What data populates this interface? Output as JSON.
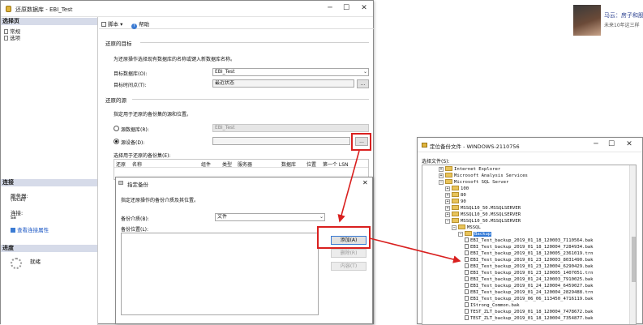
{
  "ad": {
    "title": "马云：房子和股",
    "subtitle": "未来10年这三样"
  },
  "restore": {
    "title": "还原数据库 - EBI_Test",
    "left_header": "选择页",
    "pages": [
      "常规",
      "选项"
    ],
    "toolbar": {
      "script": "脚本",
      "help": "帮助"
    },
    "target_section": "还原的目标",
    "target_desc": "为还原操作选择现有数据库的名称或键入新数据库名称。",
    "target_db_label": "目标数据库(O):",
    "target_db_value": "EBI_Test",
    "target_time_label": "目标时间点(T):",
    "target_time_value": "最近状态",
    "source_section": "还原的源",
    "source_desc": "指定用于还原的备份集的源和位置。",
    "source_db_label": "源数据库(R):",
    "source_db_value": "EBI_Test",
    "source_dev_label": "源设备(D):",
    "browse_label": "...",
    "backupsets_label": "选择用于还原的备份集(E):",
    "columns": [
      "还原",
      "名称",
      "组件",
      "类型",
      "服务器",
      "数据库",
      "位置",
      "第一个 LSN"
    ],
    "conn_header": "连接",
    "server_label": "服务器:",
    "server_value": "(local)",
    "conn_label": "连接:",
    "conn_value": "sa",
    "conn_props_link": "查看连接属性",
    "progress_header": "进度",
    "progress_status": "就绪"
  },
  "specify": {
    "title": "指定备份",
    "desc": "指定还原操作的备份介质及其位置。",
    "media_label": "备份介质(B):",
    "media_value": "文件",
    "location_label": "备份位置(L):",
    "add_button": "添加(A)",
    "remove_button": "删除(R)",
    "contents_button": "内容(T)"
  },
  "locate": {
    "title": "定位备份文件 - WINDOWS-2110756",
    "select_label": "选择文件(S):",
    "tree": [
      "Internet Explorer",
      "Microsoft Analysis Services",
      "Microsoft SQL Server",
      "100",
      "80",
      "90",
      "MSSQL10_50.MSSQLSERVER",
      "MSSQL10_50.MSSQLSERVER",
      "MSSQL10_50.MSSQLSERVER",
      "MSSQL",
      "Backup",
      "EBI_Test_backup_2019_01_18_120003_7110564.bak",
      "EBI_Test_backup_2019_01_18_120004_7284934.bak",
      "EBI_Test_backup_2019_01_18_120005_2361019.trn",
      "EBI_Test_backup_2019_01_23_120003_8031490.bak",
      "EBI_Test_backup_2019_01_23_120004_6290429.bak",
      "EBI_Test_backup_2019_01_23_120005_1407051.trn",
      "EBI_Test_backup_2019_01_24_120003_7910025.bak",
      "EBI_Test_backup_2019_01_24_120004_6459027.bak",
      "EBI_Test_backup_2019_01_24_120004_2829488.trn",
      "EBI_Test_backup_2019_06_06_113450_4716119.bak",
      "IStrong_Common.bak",
      "TEST_ZLT_backup_2019_01_18_120004_7478672.bak",
      "TEST_ZLT_backup_2019_01_18_120004_7354877.bak"
    ]
  }
}
